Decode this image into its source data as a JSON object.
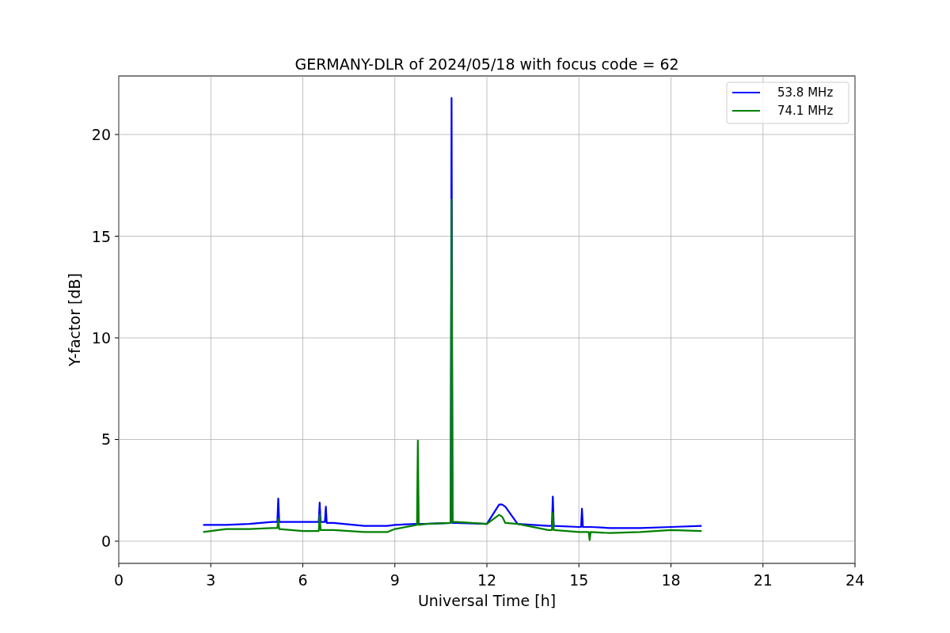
{
  "chart_data": {
    "type": "line",
    "title": "GERMANY-DLR of 2024/05/18 with focus code = 62",
    "xlabel": "Universal Time [h]",
    "ylabel": "Y-factor [dB]",
    "x": [
      2.75,
      3.5,
      4.25,
      5,
      5.17,
      5.2,
      5.23,
      6,
      6.52,
      6.55,
      6.58,
      6.72,
      6.75,
      6.78,
      7,
      8,
      8.75,
      9,
      9.72,
      9.75,
      9.78,
      10,
      10.82,
      10.85,
      10.88,
      11,
      12,
      12.4,
      12.5,
      12.6,
      13,
      14,
      14.12,
      14.15,
      14.18,
      15,
      15.07,
      15.1,
      15.13,
      15.32,
      15.35,
      15.38,
      16,
      17,
      18,
      19
    ],
    "series": [
      {
        "name": "53.8 MHz",
        "color": "#0000ff",
        "values": [
          0.8,
          0.8,
          0.85,
          0.95,
          0.95,
          2.1,
          0.95,
          0.95,
          0.95,
          1.9,
          0.95,
          0.95,
          1.7,
          0.9,
          0.9,
          0.75,
          0.75,
          0.8,
          0.85,
          0.85,
          0.85,
          0.85,
          0.9,
          21.8,
          0.9,
          0.9,
          0.85,
          1.8,
          1.8,
          1.7,
          0.85,
          0.75,
          0.75,
          2.2,
          0.75,
          0.7,
          0.7,
          1.6,
          0.7,
          0.7,
          0.7,
          0.7,
          0.65,
          0.65,
          0.7,
          0.75
        ]
      },
      {
        "name": "74.1 MHz",
        "color": "#008000",
        "values": [
          0.45,
          0.6,
          0.6,
          0.65,
          0.65,
          1.1,
          0.6,
          0.5,
          0.5,
          1.3,
          0.55,
          0.55,
          0.55,
          0.55,
          0.55,
          0.45,
          0.45,
          0.6,
          0.8,
          4.95,
          0.8,
          0.85,
          0.9,
          16.8,
          0.95,
          0.95,
          0.85,
          1.3,
          1.2,
          0.9,
          0.85,
          0.55,
          0.55,
          1.4,
          0.55,
          0.45,
          0.45,
          0.45,
          0.45,
          0.45,
          0.05,
          0.45,
          0.4,
          0.45,
          0.55,
          0.5
        ]
      }
    ],
    "grid": true,
    "legend": true,
    "xlim": [
      0,
      24
    ],
    "ylim": [
      -1.09,
      22.88
    ],
    "xticks": [
      0,
      3,
      6,
      9,
      12,
      15,
      18,
      21,
      24
    ],
    "yticks": [
      0,
      5,
      10,
      15,
      20
    ]
  }
}
